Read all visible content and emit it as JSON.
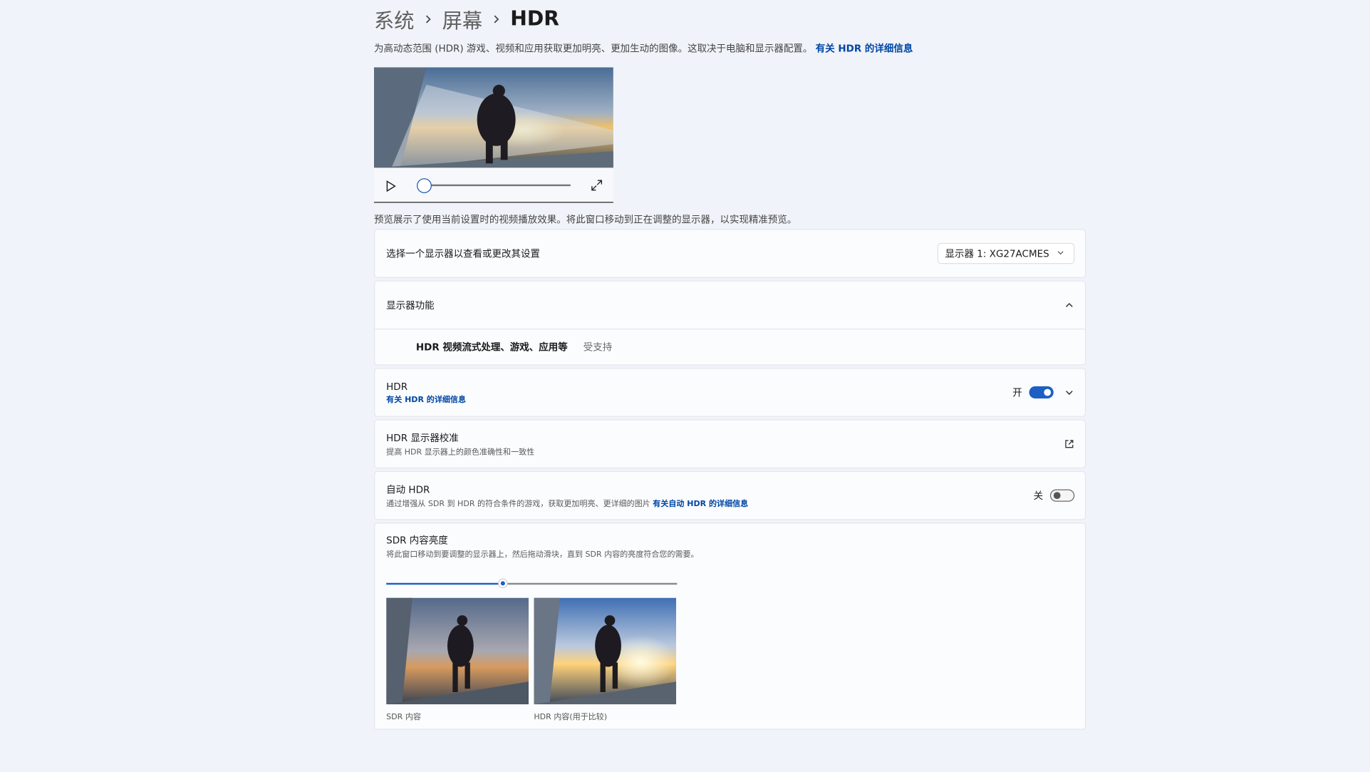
{
  "breadcrumb": {
    "items": [
      "系统",
      "屏幕"
    ],
    "current": "HDR"
  },
  "intro": {
    "text": "为高动态范围 (HDR) 游戏、视频和应用获取更加明亮、更加生动的图像。这取决于电脑和显示器配置。",
    "link": "有关 HDR 的详细信息"
  },
  "video": {
    "progress": 0.0
  },
  "preview_note": "预览展示了使用当前设置时的视频播放效果。将此窗口移动到正在调整的显示器，以实现精准预览。",
  "display_select": {
    "label": "选择一个显示器以查看或更改其设置",
    "value": "显示器 1: XG27ACMES"
  },
  "capabilities": {
    "title": "显示器功能",
    "feature": "HDR 视频流式处理、游戏、应用等",
    "status": "受支持"
  },
  "hdr": {
    "title": "HDR",
    "link": "有关 HDR 的详细信息",
    "state_label": "开",
    "on": true
  },
  "calibration": {
    "title": "HDR 显示器校准",
    "desc": "提高 HDR 显示器上的颜色准确性和一致性"
  },
  "auto_hdr": {
    "title": "自动 HDR",
    "desc": "通过增强从 SDR 到 HDR 的符合条件的游戏，获取更加明亮、更详细的图片",
    "link": "有关自动 HDR 的详细信息",
    "state_label": "关",
    "on": false
  },
  "sdr_brightness": {
    "title": "SDR 内容亮度",
    "desc": "将此窗口移动到要调整的显示器上，然后拖动滑块，直到 SDR 内容的亮度符合您的需要。",
    "value_fraction": 0.4,
    "captions": [
      "SDR 内容",
      "HDR 内容(用于比较)"
    ]
  },
  "colors": {
    "accent": "#1e5fc4",
    "link": "#0047a5",
    "background": "#f0f3f9",
    "card": "#fbfcfe"
  }
}
